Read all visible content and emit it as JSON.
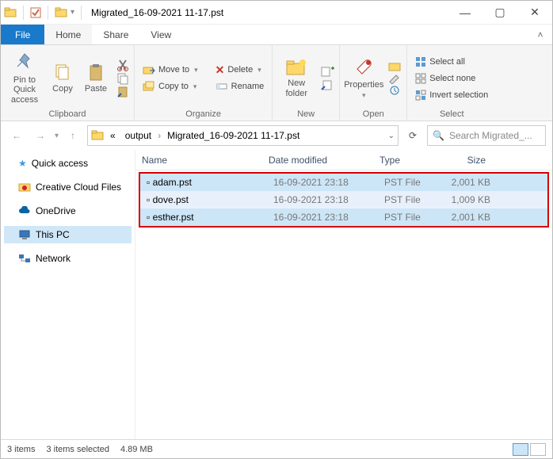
{
  "window": {
    "title": "Migrated_16-09-2021 11-17.pst"
  },
  "tabs": {
    "file": "File",
    "home": "Home",
    "share": "Share",
    "view": "View"
  },
  "ribbon": {
    "clipboard": {
      "label": "Clipboard",
      "pin": "Pin to Quick access",
      "copy": "Copy",
      "paste": "Paste"
    },
    "organize": {
      "label": "Organize",
      "moveto": "Move to",
      "copyto": "Copy to",
      "delete": "Delete",
      "rename": "Rename"
    },
    "new": {
      "label": "New",
      "newfolder": "New folder"
    },
    "open": {
      "label": "Open",
      "properties": "Properties"
    },
    "select": {
      "label": "Select",
      "all": "Select all",
      "none": "Select none",
      "invert": "Invert selection"
    }
  },
  "address": {
    "root": "«",
    "crumbs": [
      "output",
      "Migrated_16-09-2021 11-17.pst"
    ],
    "search_placeholder": "Search Migrated_..."
  },
  "nav": {
    "quick": "Quick access",
    "ccf": "Creative Cloud Files",
    "onedrive": "OneDrive",
    "thispc": "This PC",
    "network": "Network"
  },
  "columns": {
    "name": "Name",
    "date": "Date modified",
    "type": "Type",
    "size": "Size"
  },
  "files": [
    {
      "name": "adam.pst",
      "date": "16-09-2021 23:18",
      "type": "PST File",
      "size": "2,001 KB"
    },
    {
      "name": "dove.pst",
      "date": "16-09-2021 23:18",
      "type": "PST File",
      "size": "1,009 KB"
    },
    {
      "name": "esther.pst",
      "date": "16-09-2021 23:18",
      "type": "PST File",
      "size": "2,001 KB"
    }
  ],
  "status": {
    "count": "3 items",
    "selected": "3 items selected",
    "size": "4.89 MB"
  }
}
